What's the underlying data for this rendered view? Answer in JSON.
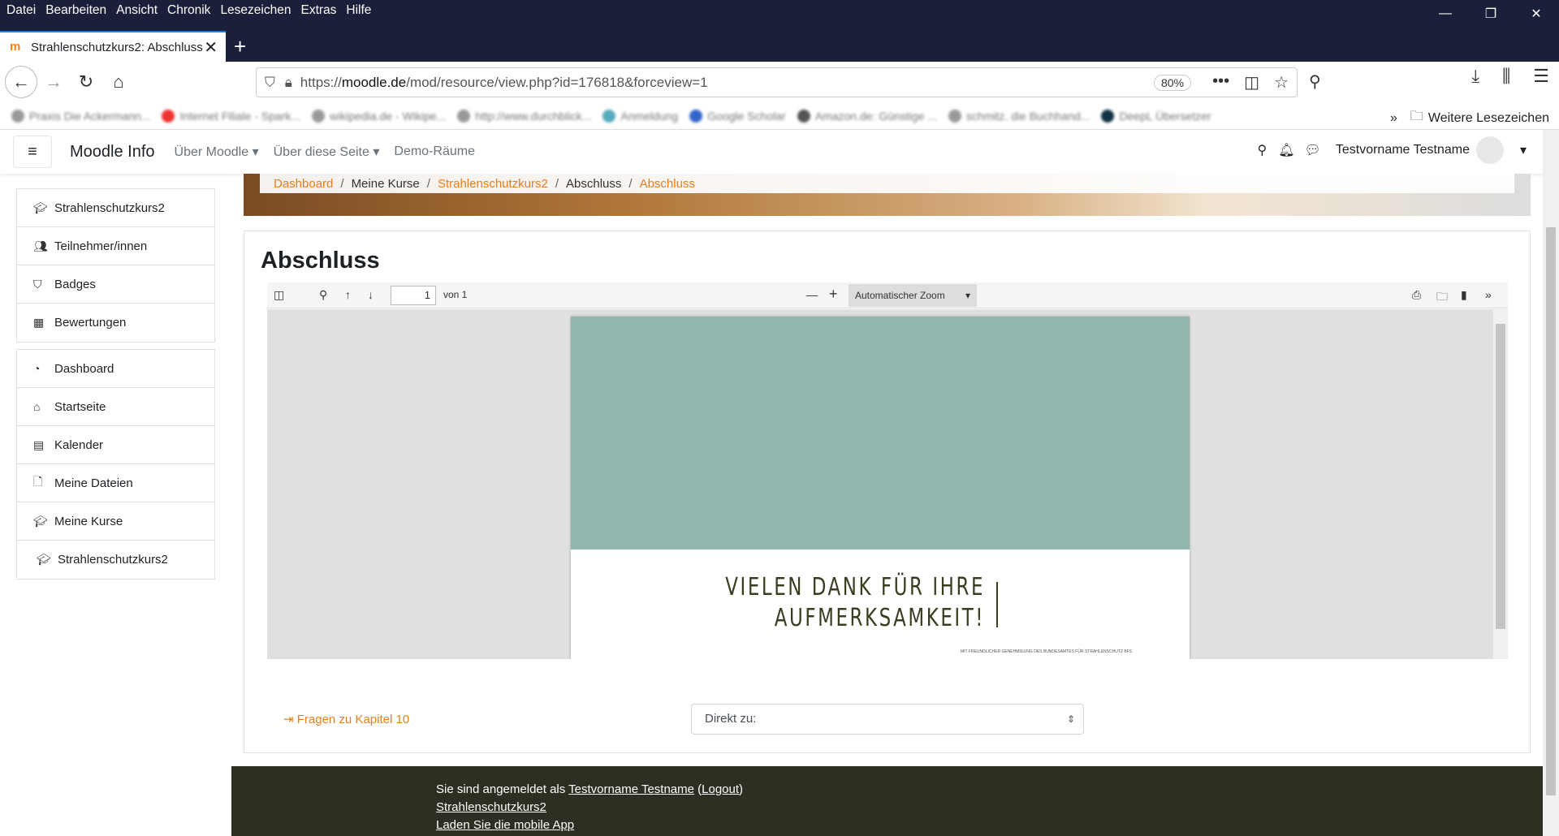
{
  "browser": {
    "menu": [
      "Datei",
      "Bearbeiten",
      "Ansicht",
      "Chronik",
      "Lesezeichen",
      "Extras",
      "Hilfe"
    ],
    "tab_title": "Strahlenschutzkurs2: Abschluss",
    "url_prefix": "https://",
    "url_host": "moodle.de",
    "url_path": "/mod/resource/view.php?id=176818&forceview=1",
    "zoom": "80%",
    "bookmarks": [
      "Praxis Die Ackermann...",
      "Internet Filiale - Spark...",
      "wikipedia.de - Wikipe...",
      "http://www.durchblick...",
      "Anmeldung",
      "Google Scholar",
      "Amazon.de: Günstige ...",
      "schmitz. die Buchhand...",
      "DeepL Übersetzer"
    ],
    "more_bookmarks": "Weitere Lesezeichen"
  },
  "moodle": {
    "brand": "Moodle Info",
    "nav": [
      "Über Moodle",
      "Über diese Seite",
      "Demo-Räume"
    ],
    "user": "Testvorname Testname"
  },
  "sidebar": {
    "group1": [
      {
        "label": "Strahlenschutzkurs2",
        "icon": "graduation-cap-icon"
      },
      {
        "label": "Teilnehmer/innen",
        "icon": "users-icon"
      },
      {
        "label": "Badges",
        "icon": "shield-icon"
      },
      {
        "label": "Bewertungen",
        "icon": "table-icon"
      }
    ],
    "group2": [
      {
        "label": "Dashboard",
        "icon": "dashboard-icon"
      },
      {
        "label": "Startseite",
        "icon": "home-icon"
      },
      {
        "label": "Kalender",
        "icon": "calendar-icon"
      },
      {
        "label": "Meine Dateien",
        "icon": "file-icon"
      },
      {
        "label": "Meine Kurse",
        "icon": "graduation-cap-icon"
      },
      {
        "label": "Strahlenschutzkurs2",
        "icon": "graduation-cap-icon"
      }
    ]
  },
  "breadcrumb": [
    "Dashboard",
    "Meine Kurse",
    "Strahlenschutzkurs2",
    "Abschluss",
    "Abschluss"
  ],
  "page": {
    "title": "Abschluss",
    "pdf": {
      "page_num": "1",
      "page_of": "von 1",
      "zoom": "Automatischer Zoom",
      "heading_line1": "VIELEN DANK FÜR IHRE",
      "heading_line2": "AUFMERKSAMKEIT!",
      "credit": "MIT FREUNDLICHER GENEHMIGUNG DES BUNDESAMTES FÜR STRAHLENSCHUTZ BFS"
    },
    "prev_link": "⇥ Fragen zu Kapitel 10",
    "jump_placeholder": "Direkt zu:"
  },
  "footer": {
    "logged_in_prefix": "Sie sind angemeldet als ",
    "user_link": "Testvorname Testname",
    "logout": "Logout",
    "course_link": "Strahlenschutzkurs2",
    "app_link": "Laden Sie die mobile App"
  }
}
